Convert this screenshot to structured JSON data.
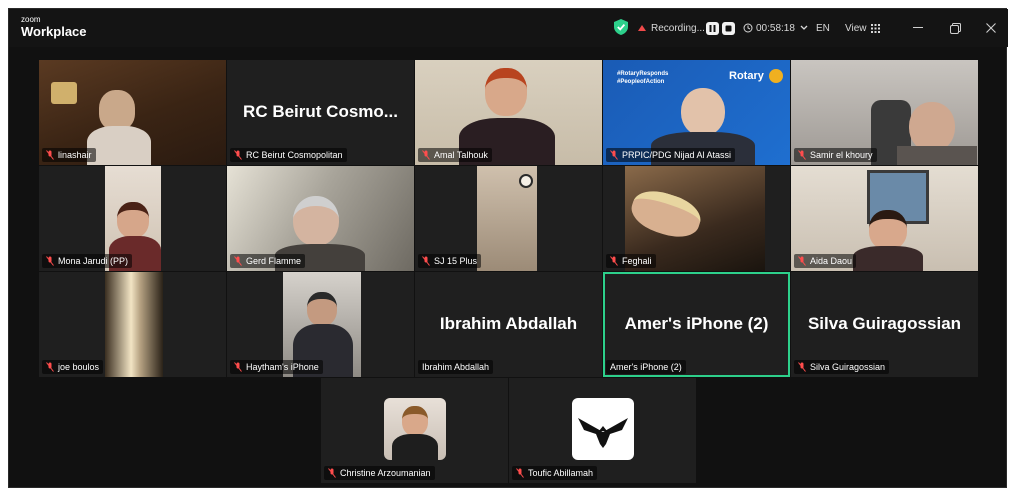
{
  "app": {
    "logo_small": "zoom",
    "logo_big": "Workplace"
  },
  "toolbar": {
    "recording_label": "Recording...",
    "timer": "00:58:18",
    "language": "EN",
    "view_label": "View",
    "security_color": "#2dd08b"
  },
  "participants": [
    {
      "name": "linashair",
      "muted": true
    },
    {
      "name": "RC Beirut Cosmopolitan",
      "display_name": "RC Beirut Cosmo...",
      "muted": true
    },
    {
      "name": "Amal Talhouk",
      "muted": true
    },
    {
      "name": "PRPIC/PDG  Nijad Al Atassi",
      "muted": true,
      "background_text": [
        "#RotaryResponds",
        "#PeopleofAction"
      ],
      "background_brand": "Rotary"
    },
    {
      "name": "Samir el khoury",
      "muted": true
    },
    {
      "name": "Mona Jarudi (PP)",
      "muted": true
    },
    {
      "name": "Gerd Flamme",
      "muted": true
    },
    {
      "name": "SJ 15 Plus",
      "muted": true
    },
    {
      "name": "Feghali",
      "muted": true
    },
    {
      "name": "Aida Daou",
      "muted": true
    },
    {
      "name": "joe boulos",
      "muted": true
    },
    {
      "name": "Haytham's iPhone",
      "muted": true
    },
    {
      "name": "Ibrahim Abdallah",
      "display_name": "Ibrahim Abdallah",
      "muted": false
    },
    {
      "name": "Amer's iPhone (2)",
      "display_name": "Amer's iPhone (2)",
      "muted": false,
      "active_speaker": true
    },
    {
      "name": "Silva Guiragossian",
      "display_name": "Silva Guiragossian",
      "muted": true
    },
    {
      "name": "Christine Arzoumanian",
      "muted": true
    },
    {
      "name": "Toufic Abillamah",
      "muted": true
    }
  ]
}
